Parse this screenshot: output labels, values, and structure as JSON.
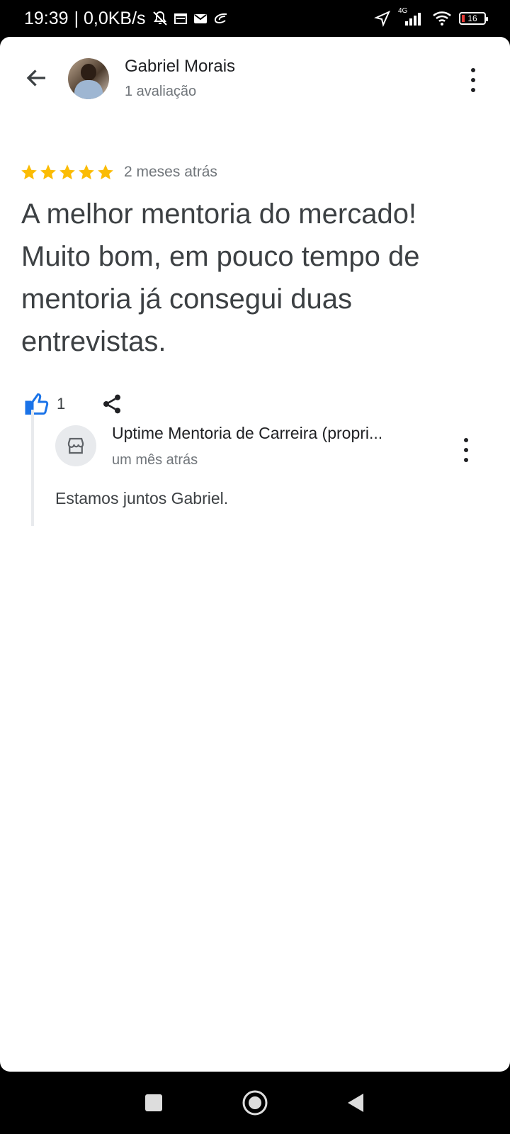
{
  "status_bar": {
    "time": "19:39",
    "speed": "| 0,0KB/s",
    "network": "4G",
    "battery": "16"
  },
  "header": {
    "name": "Gabriel Morais",
    "subtitle": "1 avaliação"
  },
  "review": {
    "rating": 5,
    "time": "2 meses atrás",
    "text": "A melhor mentoria do mercado! Muito bom, em pouco tempo de mentoria já consegui duas entrevistas.",
    "likes": "1"
  },
  "owner_reply": {
    "name": "Uptime Mentoria de Carreira (propri...",
    "time": "um mês atrás",
    "text": "Estamos juntos Gabriel."
  },
  "colors": {
    "star": "#fbbc04",
    "like": "#1a73e8",
    "text": "#3c4043",
    "muted": "#70757a"
  },
  "icons": [
    "back-arrow-icon",
    "more-vert-icon",
    "star-icon",
    "thumb-up-icon",
    "share-icon",
    "store-icon",
    "home-icon",
    "back-icon",
    "recents-icon"
  ]
}
